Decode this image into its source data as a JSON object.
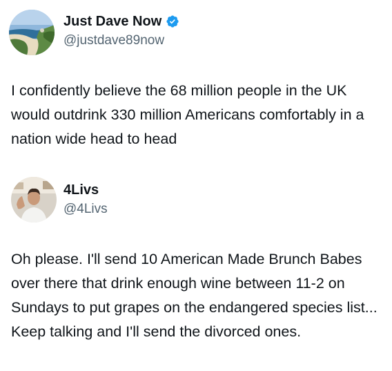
{
  "tweets": [
    {
      "author": {
        "display_name": "Just Dave Now",
        "handle": "@justdave89now",
        "verified": true,
        "avatar_icon": "coastal-landscape-avatar"
      },
      "text": "I confidently believe the 68 million people in the UK would outdrink 330 million Americans comfortably in a nation wide head to head"
    },
    {
      "author": {
        "display_name": "4Livs",
        "handle": "@4Livs",
        "verified": false,
        "avatar_icon": "person-photo-avatar"
      },
      "text": "Oh please. I'll send 10 American Made Brunch Babes over there that drink enough wine between 11-2 on Sundays to put grapes on the endangered species list... Keep talking and I'll send the divorced ones."
    }
  ],
  "colors": {
    "text": "#0f1419",
    "secondary": "#536471",
    "verified_badge": "#1d9bf0"
  }
}
